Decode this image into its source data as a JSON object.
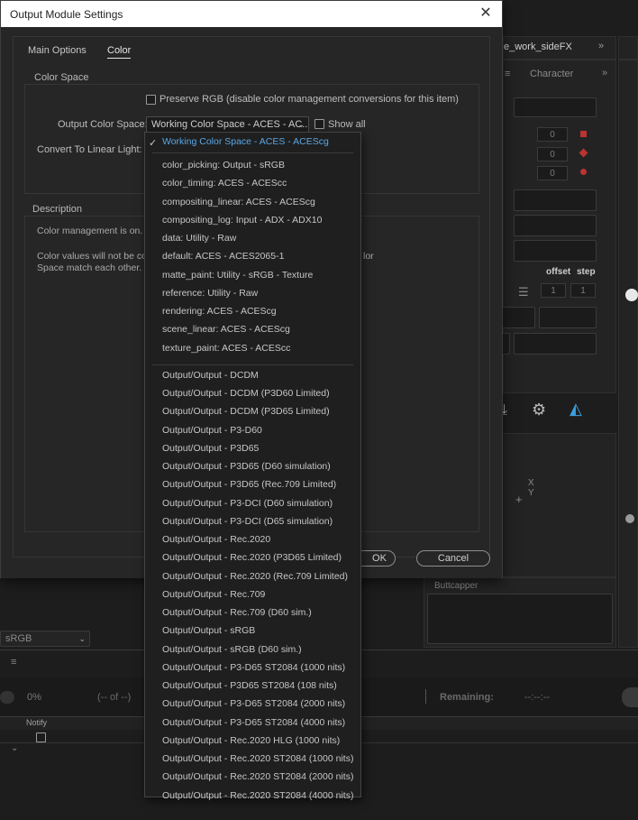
{
  "dialog": {
    "title": "Output Module Settings",
    "tabs": [
      "Main Options",
      "Color"
    ],
    "color_space_group": "Color Space",
    "preserve_rgb": "Preserve RGB (disable color management conversions for this item)",
    "output_color_space_label": "Output Color Space:",
    "output_color_space_value": "Working Color Space - ACES - AC...",
    "show_all": "Show all",
    "convert_linear_label": "Convert To Linear Light:",
    "description_group": "Description",
    "description_line1": "Color management is on. T",
    "description_line2": "Color values will not be co",
    "description_line3": "Space match each other.",
    "description_tail": "lor",
    "ok_label": "OK",
    "cancel_label": "Cancel"
  },
  "menu": {
    "selected": "Working Color Space - ACES - ACEScg",
    "group1": [
      "color_picking: Output - sRGB",
      "color_timing: ACES - ACEScc",
      "compositing_linear: ACES - ACEScg",
      "compositing_log: Input - ADX - ADX10",
      "data: Utility - Raw",
      "default: ACES - ACES2065-1",
      "matte_paint: Utility - sRGB - Texture",
      "reference: Utility - Raw",
      "rendering: ACES - ACEScg",
      "scene_linear: ACES - ACEScg",
      "texture_paint: ACES - ACEScc"
    ],
    "group2": [
      "Output/Output - DCDM",
      "Output/Output - DCDM (P3D60 Limited)",
      "Output/Output - DCDM (P3D65 Limited)",
      "Output/Output - P3-D60",
      "Output/Output - P3D65",
      "Output/Output - P3D65 (D60 simulation)",
      "Output/Output - P3D65 (Rec.709 Limited)",
      "Output/Output - P3-DCI (D60 simulation)",
      "Output/Output - P3-DCI (D65 simulation)",
      "Output/Output - Rec.2020",
      "Output/Output - Rec.2020 (P3D65 Limited)",
      "Output/Output - Rec.2020 (Rec.709 Limited)",
      "Output/Output - Rec.709",
      "Output/Output - Rec.709 (D60 sim.)",
      "Output/Output - sRGB",
      "Output/Output - sRGB (D60 sim.)",
      "Output/Output - P3-D65 ST2084 (1000 nits)",
      "Output/Output - P3D65 ST2084 (108 nits)",
      "Output/Output - P3-D65 ST2084 (2000 nits)",
      "Output/Output - P3-D65 ST2084 (4000 nits)",
      "Output/Output - Rec.2020 HLG (1000 nits)",
      "Output/Output - Rec.2020 ST2084 (1000 nits)",
      "Output/Output - Rec.2020 ST2084 (2000 nits)",
      "Output/Output - Rec.2020 ST2084 (4000 nits)"
    ]
  },
  "background": {
    "panel_title": "e_work_sideFX",
    "character_tab": "Character",
    "offset_label": "offset",
    "step_label": "step",
    "buttcapper": "Buttcapper",
    "srgb_select": "sRGB",
    "progress_pct": "0%",
    "of_label": "(-- of --)",
    "remaining_label": "Remaining:",
    "remaining_value": "--:--:--",
    "notify_label": "Notify",
    "xy_label": "X\nY",
    "numbox_value": "0",
    "small_value": "1"
  },
  "colors": {
    "accent": "#5aa7e6",
    "dialog_bg": "#262626",
    "app_bg": "#1d1d1d"
  }
}
